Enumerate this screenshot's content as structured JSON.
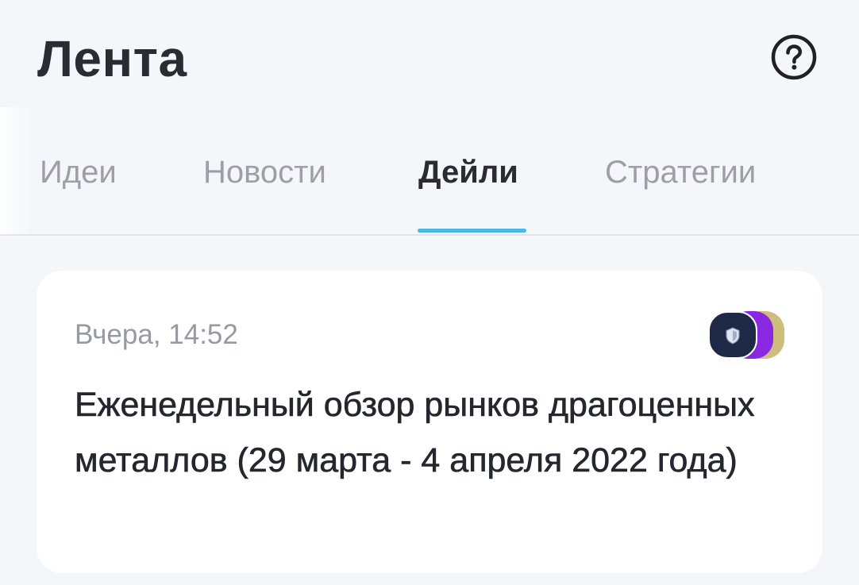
{
  "header": {
    "title": "Лента",
    "help_icon": "question-circle-icon"
  },
  "tabs": [
    {
      "label": "Идеи",
      "active": false
    },
    {
      "label": "Новости",
      "active": false
    },
    {
      "label": "Дейли",
      "active": true
    },
    {
      "label": "Стратегии",
      "active": false
    }
  ],
  "colors": {
    "accent": "#4fb7e4",
    "background": "#f5f6fa",
    "text_primary": "#2a2c33",
    "text_secondary": "#9c9fa8"
  },
  "feed": {
    "items": [
      {
        "time": "Вчера, 14:52",
        "title": "Еженедельный обзор рынков драгоценных металлов (29 марта - 4 апреля 2022 года)",
        "badges": [
          "shield-icon",
          "purple-badge",
          "gold-badge"
        ]
      }
    ]
  }
}
